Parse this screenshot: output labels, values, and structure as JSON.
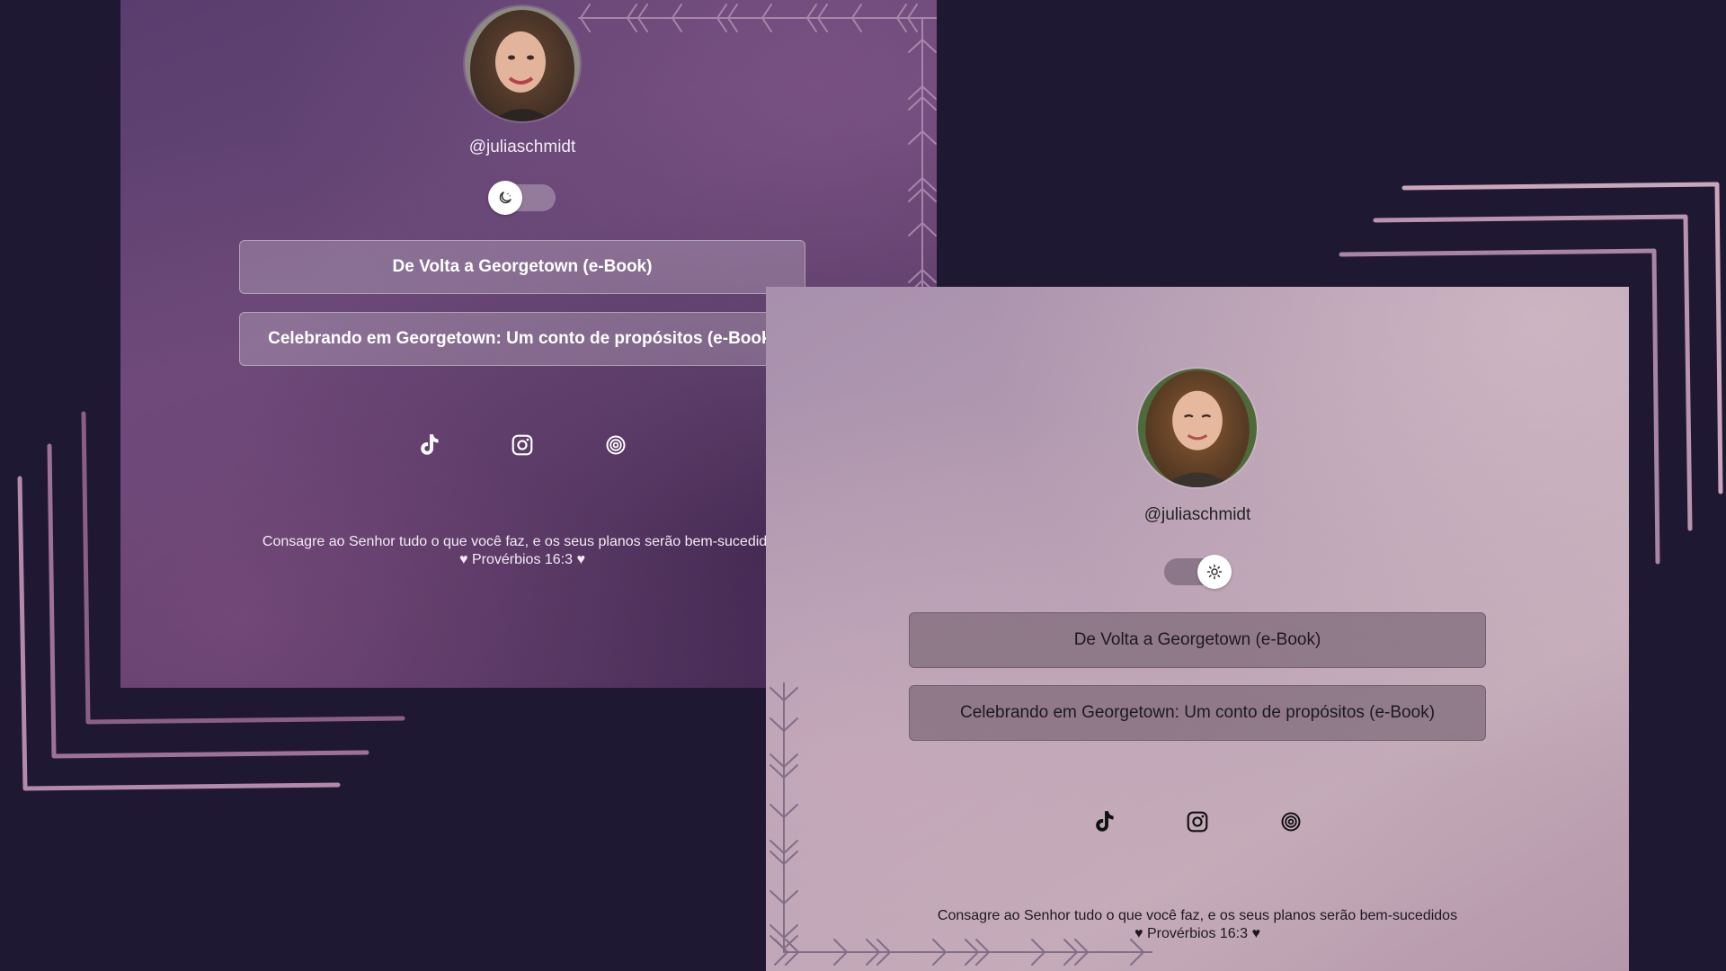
{
  "colors": {
    "background": "#1f1832",
    "dark_panel": "#5f4270",
    "light_panel": "#b9a0b4",
    "deco_stroke": "#b893b0"
  },
  "dark_theme": {
    "username": "@juliaschmidt",
    "theme_toggle": {
      "state": "dark",
      "icon": "moon-icon"
    },
    "buttons": [
      {
        "label": "De Volta a Georgetown (e-Book)"
      },
      {
        "label": "Celebrando em Georgetown: Um conto de propósitos (e-Book)"
      }
    ],
    "social_icons": [
      "tiktok-icon",
      "instagram-icon",
      "threads-icon"
    ],
    "quote": {
      "line1": "Consagre ao Senhor tudo o que você faz, e os seus planos serão bem-sucedidos",
      "line2": "♥ Provérbios 16:3 ♥"
    }
  },
  "light_theme": {
    "username": "@juliaschmidt",
    "theme_toggle": {
      "state": "light",
      "icon": "sun-icon"
    },
    "buttons": [
      {
        "label": "De Volta a Georgetown (e-Book)"
      },
      {
        "label": "Celebrando em Georgetown: Um conto de propósitos (e-Book)"
      }
    ],
    "social_icons": [
      "tiktok-icon",
      "instagram-icon",
      "threads-icon"
    ],
    "quote": {
      "line1": "Consagre ao Senhor tudo o que você faz, e os seus planos serão bem-sucedidos",
      "line2": "♥ Provérbios 16:3 ♥"
    }
  }
}
